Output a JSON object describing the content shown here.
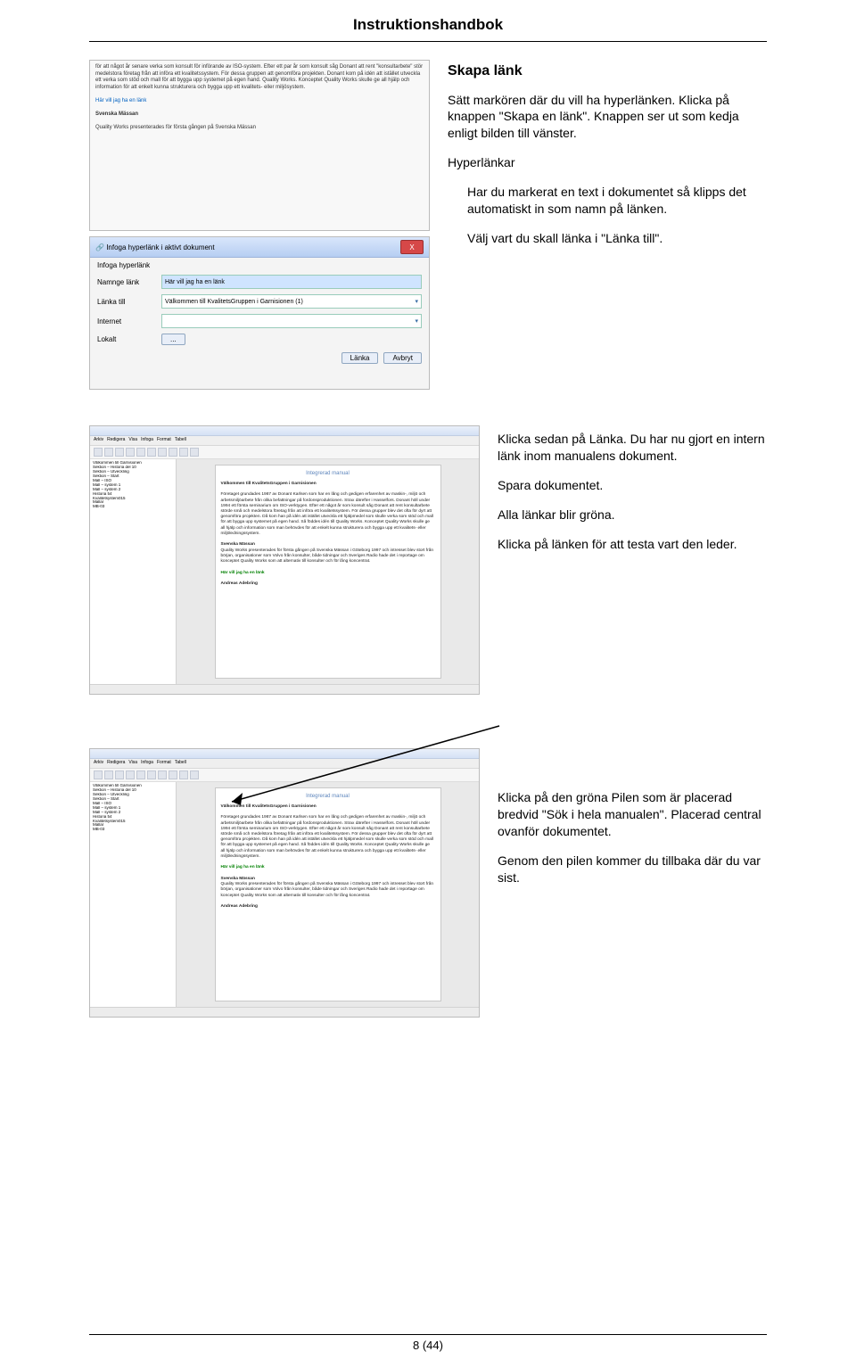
{
  "header": {
    "title": "Instruktionshandbok"
  },
  "footer": {
    "page": "8 (44)"
  },
  "screenshot1": {
    "body_text": "för att något år senare verka som konsult för införande av ISO-system. Efter ett par år som konsult såg Donant att rent \"konsultarbete\" stör medelstora företag från att införa ett kvalitetssystem. För dessa gruppen att genomföra projekten. Donant kom på idén att istället utveckla ett verka som stöd och mall för att bygga upp systemet på egen hand. Quality Works. Konceptet Quality Works skulle ge all hjälp och information för att enkelt kunna strukturera och bygga upp ett kvalitets- eller miljösystem.",
    "link": "Här vill jag ha en länk",
    "heading2": "Svenska Mässan",
    "line2": "Quality Works presenterades för första gången på Svenska Mässan"
  },
  "dialog": {
    "title": "Infoga hyperlänk i aktivt dokument",
    "close": "X",
    "sub": "Infoga hyperlänk",
    "l_name": "Namnge länk",
    "i_name": "Här vill jag ha en länk",
    "l_target": "Länka till",
    "i_target": "Välkommen till KvalitetsGruppen  i Garnisionen (1)",
    "l_internet": "Internet",
    "l_local": "Lokalt",
    "btn_dots": "...",
    "btn_link": "Länka",
    "btn_cancel": "Avbryt"
  },
  "section1": {
    "heading": "Skapa länk",
    "p1": "Sätt markören där du vill ha hyperlänken. Klicka på knappen \"Skapa en länk\". Knappen ser ut som kedja enligt bilden till vänster.",
    "sub": "Hyperlänkar",
    "p2": "Har du markerat en text i dokumentet så klipps det automatiskt in som namn på länken.",
    "p3": "Välj vart du skall länka i \"Länka till\"."
  },
  "widewin": {
    "tree": [
      "Välkommen till Garnisionen",
      "Sektion – Historia del 10",
      "Sektion – Utveckling",
      "Sektion – Start",
      "Mall – ISO",
      "Mall – system 1",
      "Mall – system 2",
      "Historia 54",
      "Kvalitetsystem015",
      "Mallar",
      "MB-03"
    ],
    "doc_title": "Integrerad manual",
    "doc_h": "Välkommen till KvalitetsGruppen i Garnisionen",
    "doc_body": "Företaget grundades 1987 av Donant Karlsen som har en lång och gedigen erfarenhet av maskin-, miljö och arbetsmiljöarbete från olika befattningar på fordonsproduktionen. Strax därefter i Hasselfors. Donant höll under 1994 ett första seminarium om ISO-verktygen. Efter ett något år som konsult såg Donant att rent konsultarbete störde små och medelstora företag från att införa ett kvalitetssystem. För dessa grupper blev det ofta för dyrt att genomföra projekten. Då kom han på idén att istället utveckla ett hjälpmedel som skulle verka som stöd och mall för att bygga upp systemet på egen hand. Så föddes idén till Quality Works. Konceptet Quality Works skulle ge all hjälp och information som man behövdes för att enkelt kunna strukturera och bygga upp ett kvalitets- eller miljöledningssystem.",
    "doc_h2": "Svenska Mässan",
    "doc_body2": "Quality Works presenterades för första gången på Svenska Mässan i Göteborg 1997 och intresset blev stort från början, organisationer som Volvo från konsulter, både tidningar och Sveriges Radio hade det i reportage om konceptet Quality Works som att alternativ till konsulter och för lång koncentrat.",
    "green_link": "Här vill jag ha en länk",
    "sig": "Andreas Adebring"
  },
  "section2": {
    "p1": "Klicka sedan på Länka. Du har nu gjort en intern länk inom manualens dokument.",
    "p2": "Spara dokumentet.",
    "p3": "Alla länkar blir gröna.",
    "p4": "Klicka på länken för att testa vart den leder."
  },
  "section3": {
    "p1": "Klicka på den gröna Pilen som är placerad bredvid \"Sök i hela manualen\". Placerad central ovanför dokumentet.",
    "p2": "Genom den pilen kommer du tillbaka där du var sist."
  }
}
